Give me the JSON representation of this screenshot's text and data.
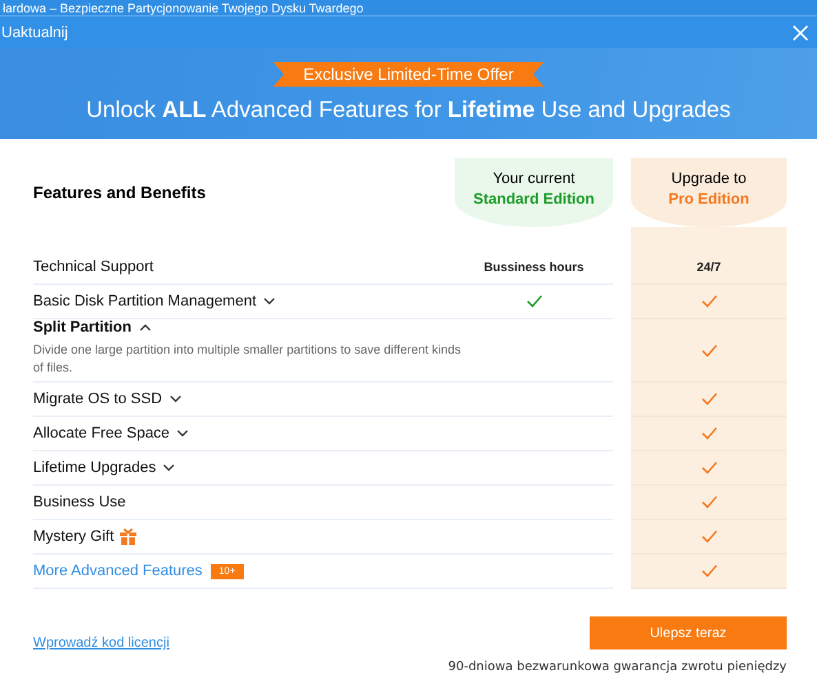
{
  "background_window": {
    "title": "łardowa – Bezpieczne Partycjonowanie Twojego Dysku Twardego"
  },
  "window": {
    "title": "Uaktualnij"
  },
  "hero": {
    "ribbon": "Exclusive Limited-Time Offer",
    "headline": "Unlock **ALL** Advanced Features for **Lifetime** Use and Upgrades"
  },
  "table": {
    "heading": "Features and Benefits",
    "columns": [
      {
        "line_1": "Your current",
        "line_2": "Standard Edition"
      },
      {
        "line_1": "Upgrade to",
        "line_2": "Pro Edition"
      }
    ],
    "rows": [
      {
        "kind": "plain",
        "label": "Technical Support",
        "cells": [
          {
            "kind": "text",
            "text": "Bussiness hours"
          },
          {
            "kind": "text",
            "text": "24/7"
          }
        ]
      },
      {
        "kind": "expandable",
        "label": "Basic Disk Partition Management",
        "expanded": false,
        "cells": [
          {
            "kind": "check"
          },
          {
            "kind": "check"
          }
        ]
      },
      {
        "kind": "expandable",
        "label": "Split Partition",
        "expanded": true,
        "description": "Divide one large partition into multiple smaller partitions to save different kinds of files.",
        "cells": [
          {
            "kind": "none"
          },
          {
            "kind": "check"
          }
        ]
      },
      {
        "kind": "expandable",
        "label": "Migrate OS to SSD",
        "expanded": false,
        "cells": [
          {
            "kind": "none"
          },
          {
            "kind": "check"
          }
        ]
      },
      {
        "kind": "expandable",
        "label": "Allocate Free Space",
        "expanded": false,
        "cells": [
          {
            "kind": "none"
          },
          {
            "kind": "check"
          }
        ]
      },
      {
        "kind": "expandable",
        "label": "Lifetime Upgrades",
        "expanded": false,
        "cells": [
          {
            "kind": "none"
          },
          {
            "kind": "check"
          }
        ]
      },
      {
        "kind": "plain",
        "label": "Business Use",
        "cells": [
          {
            "kind": "none"
          },
          {
            "kind": "check"
          }
        ]
      },
      {
        "kind": "gift",
        "label": "Mystery Gift",
        "cells": [
          {
            "kind": "none"
          },
          {
            "kind": "check"
          }
        ]
      },
      {
        "kind": "link",
        "label": "More Advanced Features",
        "badge": "10+",
        "cells": [
          {
            "kind": "none"
          },
          {
            "kind": "check"
          }
        ]
      }
    ]
  },
  "footer": {
    "license_link": "Wprowadź kod licencji",
    "upgrade_button": "Ulepsz teraz",
    "guarantee": "90-dniowa bezwarunkowa gwarancja zwrotu pieniędzy"
  }
}
